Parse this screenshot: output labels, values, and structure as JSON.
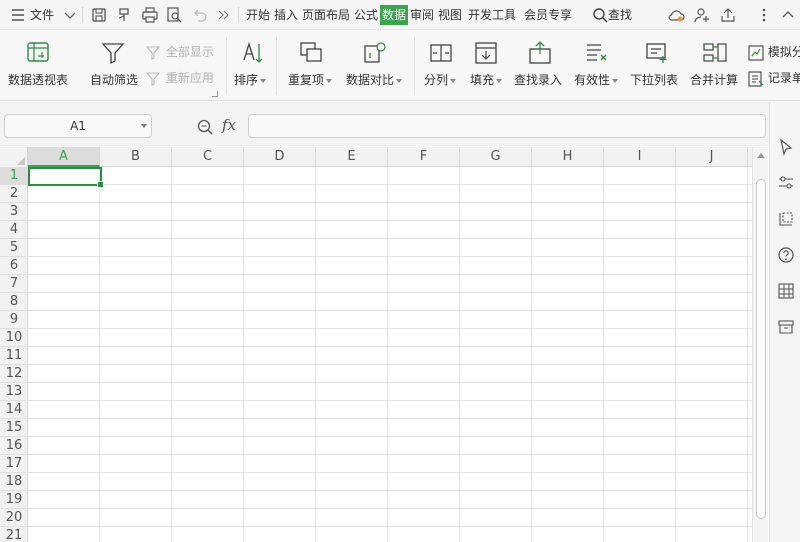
{
  "menubar": {
    "file_label": "文件",
    "tabs": [
      {
        "label": "开始",
        "active": false
      },
      {
        "label": "插入",
        "active": false
      },
      {
        "label": "页面布局",
        "active": false
      },
      {
        "label": "公式",
        "active": false
      },
      {
        "label": "数据",
        "active": true
      },
      {
        "label": "审阅",
        "active": false
      },
      {
        "label": "视图",
        "active": false
      },
      {
        "label": "开发工具",
        "active": false
      },
      {
        "label": "会员专享",
        "active": false
      }
    ],
    "search_label": "查找",
    "accent_color": "#3aa34d"
  },
  "ribbon": {
    "pivot_table": "数据透视表",
    "auto_filter": "自动筛选",
    "show_all": "全部显示",
    "reapply": "重新应用",
    "sort": "排序",
    "duplicates": "重复项",
    "compare": "数据对比",
    "split": "分列",
    "fill": "填充",
    "lookup_entry": "查找录入",
    "validity": "有效性",
    "dropdown_list": "下拉列表",
    "consolidate": "合并计算",
    "simulate": "模拟分",
    "record": "记录单"
  },
  "formula_bar": {
    "name_box": "A1",
    "fx_label": "fx",
    "formula": ""
  },
  "grid": {
    "columns": [
      "A",
      "B",
      "C",
      "D",
      "E",
      "F",
      "G",
      "H",
      "I",
      "J"
    ],
    "rows": [
      "1",
      "2",
      "3",
      "4",
      "5",
      "6",
      "7",
      "8",
      "9",
      "10",
      "11",
      "12",
      "13",
      "14",
      "15",
      "16",
      "17",
      "18",
      "19",
      "20",
      "21"
    ],
    "active_cell": "A1",
    "active_color": "#2e8b40"
  }
}
